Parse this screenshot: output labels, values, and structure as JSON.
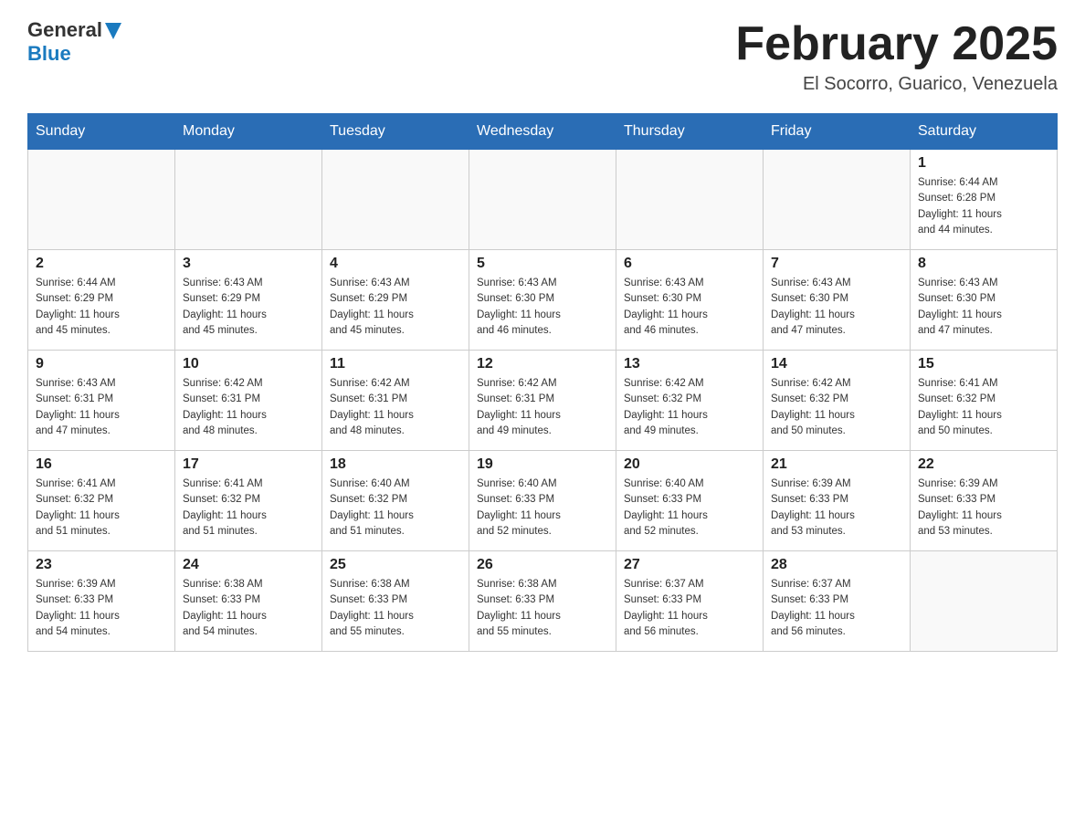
{
  "header": {
    "logo_general": "General",
    "logo_blue": "Blue",
    "month_title": "February 2025",
    "location": "El Socorro, Guarico, Venezuela"
  },
  "days_of_week": [
    "Sunday",
    "Monday",
    "Tuesday",
    "Wednesday",
    "Thursday",
    "Friday",
    "Saturday"
  ],
  "weeks": [
    [
      {
        "day": "",
        "info": ""
      },
      {
        "day": "",
        "info": ""
      },
      {
        "day": "",
        "info": ""
      },
      {
        "day": "",
        "info": ""
      },
      {
        "day": "",
        "info": ""
      },
      {
        "day": "",
        "info": ""
      },
      {
        "day": "1",
        "info": "Sunrise: 6:44 AM\nSunset: 6:28 PM\nDaylight: 11 hours\nand 44 minutes."
      }
    ],
    [
      {
        "day": "2",
        "info": "Sunrise: 6:44 AM\nSunset: 6:29 PM\nDaylight: 11 hours\nand 45 minutes."
      },
      {
        "day": "3",
        "info": "Sunrise: 6:43 AM\nSunset: 6:29 PM\nDaylight: 11 hours\nand 45 minutes."
      },
      {
        "day": "4",
        "info": "Sunrise: 6:43 AM\nSunset: 6:29 PM\nDaylight: 11 hours\nand 45 minutes."
      },
      {
        "day": "5",
        "info": "Sunrise: 6:43 AM\nSunset: 6:30 PM\nDaylight: 11 hours\nand 46 minutes."
      },
      {
        "day": "6",
        "info": "Sunrise: 6:43 AM\nSunset: 6:30 PM\nDaylight: 11 hours\nand 46 minutes."
      },
      {
        "day": "7",
        "info": "Sunrise: 6:43 AM\nSunset: 6:30 PM\nDaylight: 11 hours\nand 47 minutes."
      },
      {
        "day": "8",
        "info": "Sunrise: 6:43 AM\nSunset: 6:30 PM\nDaylight: 11 hours\nand 47 minutes."
      }
    ],
    [
      {
        "day": "9",
        "info": "Sunrise: 6:43 AM\nSunset: 6:31 PM\nDaylight: 11 hours\nand 47 minutes."
      },
      {
        "day": "10",
        "info": "Sunrise: 6:42 AM\nSunset: 6:31 PM\nDaylight: 11 hours\nand 48 minutes."
      },
      {
        "day": "11",
        "info": "Sunrise: 6:42 AM\nSunset: 6:31 PM\nDaylight: 11 hours\nand 48 minutes."
      },
      {
        "day": "12",
        "info": "Sunrise: 6:42 AM\nSunset: 6:31 PM\nDaylight: 11 hours\nand 49 minutes."
      },
      {
        "day": "13",
        "info": "Sunrise: 6:42 AM\nSunset: 6:32 PM\nDaylight: 11 hours\nand 49 minutes."
      },
      {
        "day": "14",
        "info": "Sunrise: 6:42 AM\nSunset: 6:32 PM\nDaylight: 11 hours\nand 50 minutes."
      },
      {
        "day": "15",
        "info": "Sunrise: 6:41 AM\nSunset: 6:32 PM\nDaylight: 11 hours\nand 50 minutes."
      }
    ],
    [
      {
        "day": "16",
        "info": "Sunrise: 6:41 AM\nSunset: 6:32 PM\nDaylight: 11 hours\nand 51 minutes."
      },
      {
        "day": "17",
        "info": "Sunrise: 6:41 AM\nSunset: 6:32 PM\nDaylight: 11 hours\nand 51 minutes."
      },
      {
        "day": "18",
        "info": "Sunrise: 6:40 AM\nSunset: 6:32 PM\nDaylight: 11 hours\nand 51 minutes."
      },
      {
        "day": "19",
        "info": "Sunrise: 6:40 AM\nSunset: 6:33 PM\nDaylight: 11 hours\nand 52 minutes."
      },
      {
        "day": "20",
        "info": "Sunrise: 6:40 AM\nSunset: 6:33 PM\nDaylight: 11 hours\nand 52 minutes."
      },
      {
        "day": "21",
        "info": "Sunrise: 6:39 AM\nSunset: 6:33 PM\nDaylight: 11 hours\nand 53 minutes."
      },
      {
        "day": "22",
        "info": "Sunrise: 6:39 AM\nSunset: 6:33 PM\nDaylight: 11 hours\nand 53 minutes."
      }
    ],
    [
      {
        "day": "23",
        "info": "Sunrise: 6:39 AM\nSunset: 6:33 PM\nDaylight: 11 hours\nand 54 minutes."
      },
      {
        "day": "24",
        "info": "Sunrise: 6:38 AM\nSunset: 6:33 PM\nDaylight: 11 hours\nand 54 minutes."
      },
      {
        "day": "25",
        "info": "Sunrise: 6:38 AM\nSunset: 6:33 PM\nDaylight: 11 hours\nand 55 minutes."
      },
      {
        "day": "26",
        "info": "Sunrise: 6:38 AM\nSunset: 6:33 PM\nDaylight: 11 hours\nand 55 minutes."
      },
      {
        "day": "27",
        "info": "Sunrise: 6:37 AM\nSunset: 6:33 PM\nDaylight: 11 hours\nand 56 minutes."
      },
      {
        "day": "28",
        "info": "Sunrise: 6:37 AM\nSunset: 6:33 PM\nDaylight: 11 hours\nand 56 minutes."
      },
      {
        "day": "",
        "info": ""
      }
    ]
  ]
}
